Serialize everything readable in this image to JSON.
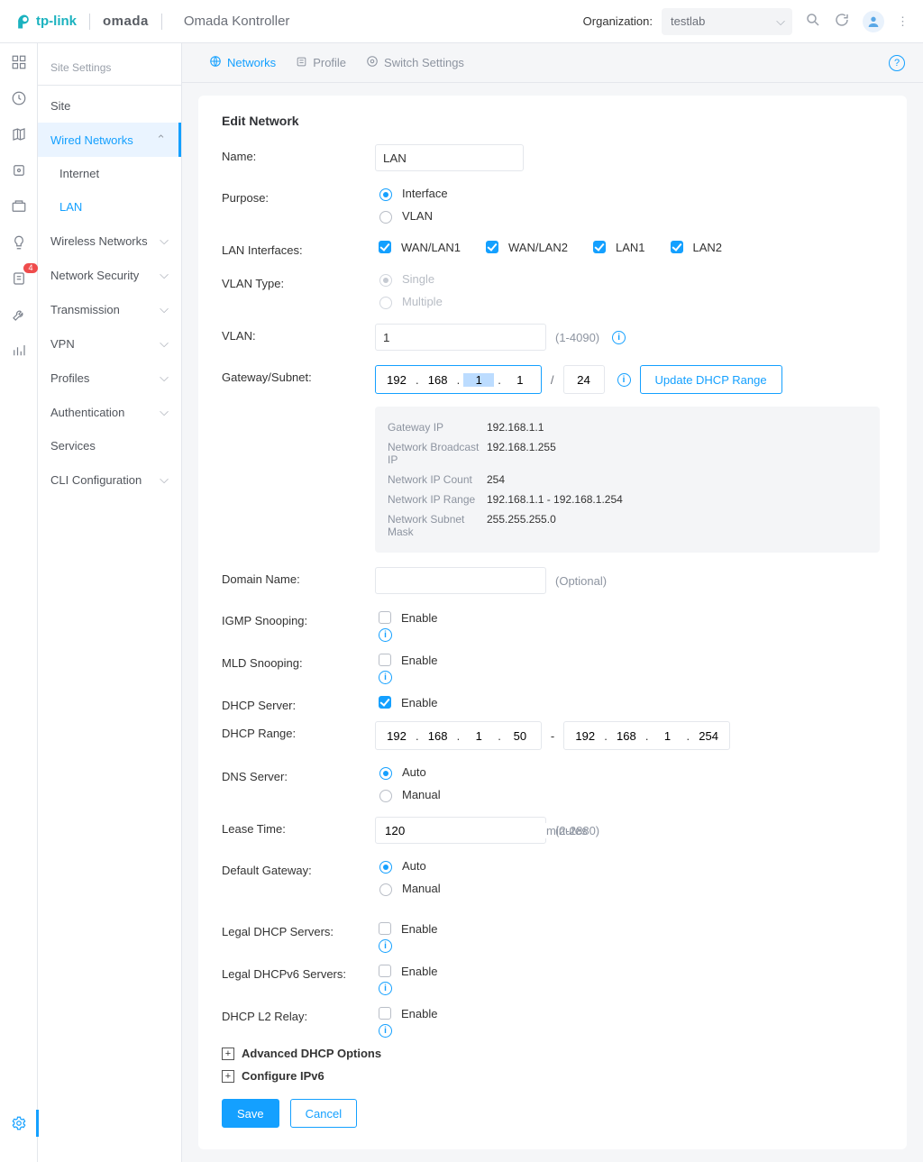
{
  "header": {
    "brand_tp": "tp-link",
    "brand_omada": "omada",
    "app_name": "Omada Kontroller",
    "org_label": "Organization:",
    "org_value": "testlab"
  },
  "rail": {
    "notif_count": "4"
  },
  "sidebar": {
    "header": "Site Settings",
    "items": [
      {
        "label": "Site"
      },
      {
        "label": "Wired Networks",
        "expandable": true,
        "open": true,
        "active": true
      },
      {
        "label": "Internet",
        "sub": true
      },
      {
        "label": "LAN",
        "sub": true,
        "selected": true
      },
      {
        "label": "Wireless Networks",
        "expandable": true
      },
      {
        "label": "Network Security",
        "expandable": true
      },
      {
        "label": "Transmission",
        "expandable": true
      },
      {
        "label": "VPN",
        "expandable": true
      },
      {
        "label": "Profiles",
        "expandable": true
      },
      {
        "label": "Authentication",
        "expandable": true
      },
      {
        "label": "Services"
      },
      {
        "label": "CLI Configuration",
        "expandable": true
      }
    ]
  },
  "tabs": {
    "networks": "Networks",
    "profile": "Profile",
    "switch_settings": "Switch Settings"
  },
  "form": {
    "title": "Edit Network",
    "name_label": "Name:",
    "name_value": "LAN",
    "purpose_label": "Purpose:",
    "purpose_interface": "Interface",
    "purpose_vlan": "VLAN",
    "lan_if_label": "LAN Interfaces:",
    "lan_if_options": [
      "WAN/LAN1",
      "WAN/LAN2",
      "LAN1",
      "LAN2"
    ],
    "vlan_type_label": "VLAN Type:",
    "vlan_type_single": "Single",
    "vlan_type_multiple": "Multiple",
    "vlan_label": "VLAN:",
    "vlan_value": "1",
    "vlan_hint": "(1-4090)",
    "gw_label": "Gateway/Subnet:",
    "gw_ip": [
      "192",
      "168",
      "1",
      "1"
    ],
    "gw_mask": "24",
    "update_dhcp_btn": "Update DHCP Range",
    "gw_info": {
      "k1": "Gateway IP",
      "v1": "192.168.1.1",
      "k2": "Network Broadcast IP",
      "v2": "192.168.1.255",
      "k3": "Network IP Count",
      "v3": "254",
      "k4": "Network IP Range",
      "v4": "192.168.1.1 - 192.168.1.254",
      "k5": "Network Subnet Mask",
      "v5": "255.255.255.0"
    },
    "domain_label": "Domain Name:",
    "domain_value": "",
    "optional": "(Optional)",
    "igmp_label": "IGMP Snooping:",
    "mld_label": "MLD Snooping:",
    "dhcp_server_label": "DHCP Server:",
    "enable": "Enable",
    "dhcp_range_label": "DHCP Range:",
    "dhcp_from": [
      "192",
      "168",
      "1",
      "50"
    ],
    "dhcp_to": [
      "192",
      "168",
      "1",
      "254"
    ],
    "dns_label": "DNS Server:",
    "auto": "Auto",
    "manual": "Manual",
    "lease_label": "Lease Time:",
    "lease_value": "120",
    "lease_unit": "minutes",
    "lease_hint": "(2-2880)",
    "default_gw_label": "Default Gateway:",
    "legal_dhcp_label": "Legal DHCP Servers:",
    "legal_dhcpv6_label": "Legal DHCPv6 Servers:",
    "dhcp_l2_label": "DHCP L2 Relay:",
    "adv_dhcp": "Advanced DHCP Options",
    "conf_ipv6": "Configure IPv6",
    "save": "Save",
    "cancel": "Cancel"
  }
}
